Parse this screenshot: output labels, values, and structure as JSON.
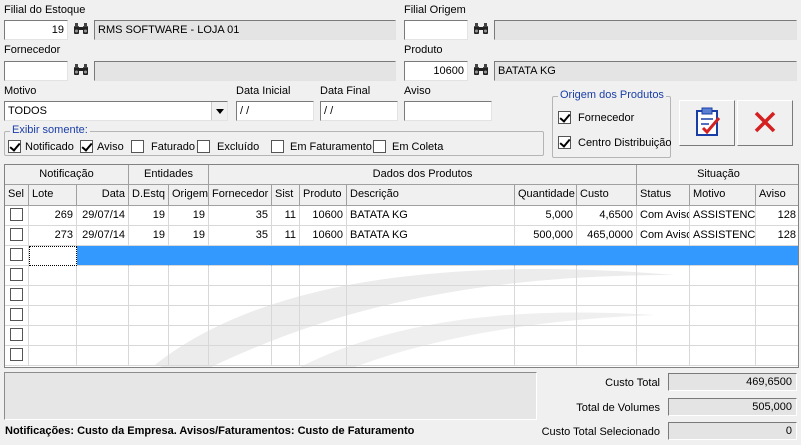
{
  "filial": {
    "label": "Filial do Estoque",
    "code": "19",
    "name": "RMS SOFTWARE - LOJA 01"
  },
  "filial_origem": {
    "label": "Filial Origem",
    "code": "",
    "name": ""
  },
  "fornecedor": {
    "label": "Fornecedor",
    "code": "",
    "name": ""
  },
  "produto": {
    "label": "Produto",
    "code": "10600",
    "name": "BATATA KG"
  },
  "motivo": {
    "label": "Motivo",
    "selected": "TODOS"
  },
  "data_inicial": {
    "label": "Data Inicial",
    "value": " / /"
  },
  "data_final": {
    "label": "Data Final",
    "value": " / /"
  },
  "aviso": {
    "label": "Aviso",
    "value": ""
  },
  "exibir": {
    "title": "Exibir somente:",
    "options": [
      {
        "label": "Notificado",
        "checked": true
      },
      {
        "label": "Aviso",
        "checked": true
      },
      {
        "label": "Faturado",
        "checked": false
      },
      {
        "label": "Excluído",
        "checked": false
      },
      {
        "label": "Em Faturamento",
        "checked": false
      },
      {
        "label": "Em Coleta",
        "checked": false
      }
    ]
  },
  "origem_produtos": {
    "title": "Origem dos  Produtos",
    "options": [
      {
        "label": "Fornecedor",
        "checked": true
      },
      {
        "label": "Centro Distribuição",
        "checked": true
      }
    ]
  },
  "grid": {
    "groups": [
      "Notificação",
      "Entidades",
      "Dados dos Produtos",
      "Situação"
    ],
    "columns": [
      "Sel",
      "Lote",
      "Data",
      "D.Estq",
      "Origem",
      "Fornecedor",
      "Sist",
      "Produto",
      "Descrição",
      "Quantidade",
      "Custo",
      "Status",
      "Motivo",
      "Aviso"
    ],
    "rows": [
      {
        "sel": false,
        "lote": "269",
        "data": "29/07/14",
        "destq": "19",
        "origem": "19",
        "fornecedor": "35",
        "sist": "11",
        "produto": "10600",
        "descricao": "BATATA KG",
        "quantidade": "5,000",
        "custo": "4,6500",
        "status": "Com Aviso",
        "motivo": "ASSISTENCIA",
        "aviso": "128"
      },
      {
        "sel": false,
        "lote": "273",
        "data": "29/07/14",
        "destq": "19",
        "origem": "19",
        "fornecedor": "35",
        "sist": "11",
        "produto": "10600",
        "descricao": "BATATA KG",
        "quantidade": "500,000",
        "custo": "465,0000",
        "status": "Com Aviso",
        "motivo": "ASSISTENCIA",
        "aviso": "128"
      }
    ],
    "empty_rows": 6
  },
  "totals": {
    "custo_total_label": "Custo Total",
    "custo_total": "469,6500",
    "total_volumes_label": "Total de Volumes",
    "total_volumes": "505,000",
    "custo_selecionado_label": "Custo Total Selecionado",
    "custo_selecionado": "0"
  },
  "footer_note": "Notificações: Custo da Empresa. Avisos/Faturamentos: Custo de Faturamento",
  "colors": {
    "selection": "#3399ff",
    "group_title": "#1a3ea8",
    "cancel_x": "#d42020"
  }
}
